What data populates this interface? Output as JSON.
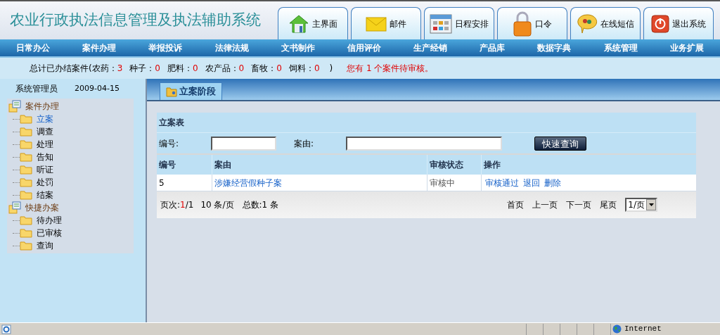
{
  "header": {
    "title": "农业行政执法信息管理及执法辅助系统",
    "toolbar": [
      "主界面",
      "邮件",
      "日程安排",
      "口令",
      "在线短信",
      "退出系统"
    ]
  },
  "nav": [
    "日常办公",
    "案件办理",
    "举报投诉",
    "法律法规",
    "文书制作",
    "信用评价",
    "生产经销",
    "产品库",
    "数据字典",
    "系统管理",
    "业务扩展"
  ],
  "stats": {
    "prefix": "总计已办结案件(",
    "counts": [
      {
        "label": "农药：",
        "value": "3"
      },
      {
        "label": "种子：",
        "value": "0"
      },
      {
        "label": "肥料：",
        "value": "0"
      },
      {
        "label": "农产品：",
        "value": "0"
      },
      {
        "label": "畜牧：",
        "value": "0"
      },
      {
        "label": "饲料：",
        "value": "0"
      }
    ],
    "suffix": ")",
    "notice": "您有 1 个案件待审核。"
  },
  "sidebar": {
    "user": "系统管理员",
    "date": "2009-04-15",
    "tree": [
      {
        "label": "案件办理",
        "children": [
          {
            "label": "立案",
            "selected": true
          },
          {
            "label": "调查",
            "selected": false
          },
          {
            "label": "处理",
            "selected": false
          },
          {
            "label": "告知",
            "selected": false
          },
          {
            "label": "听证",
            "selected": false
          },
          {
            "label": "处罚",
            "selected": false
          },
          {
            "label": "结案",
            "selected": false
          }
        ]
      },
      {
        "label": "快捷办案",
        "children": [
          {
            "label": "待办理",
            "selected": false
          },
          {
            "label": "已审核",
            "selected": false
          },
          {
            "label": "查询",
            "selected": false
          }
        ]
      }
    ]
  },
  "main": {
    "tab": "立案阶段",
    "form": {
      "title": "立案表",
      "fields": [
        {
          "label": "编号:"
        },
        {
          "label": "案由:"
        }
      ],
      "button": "快速查询"
    },
    "table": {
      "columns": [
        "编号",
        "案由",
        "审核状态",
        "操作"
      ],
      "rows": [
        {
          "cells": [
            "5",
            "涉嫌经营假种子案",
            "审核中"
          ],
          "actions": [
            "审核通过",
            "退回",
            "删除"
          ]
        }
      ]
    },
    "pager": {
      "label": "页次:",
      "current": "1",
      "total": "/1",
      "per_page": "10 条/页",
      "count": "总数:1 条",
      "links": [
        "首页",
        "上一页",
        "下一页",
        "尾页"
      ],
      "select": "1/页"
    }
  },
  "status_bar": {
    "zone": "Internet"
  }
}
